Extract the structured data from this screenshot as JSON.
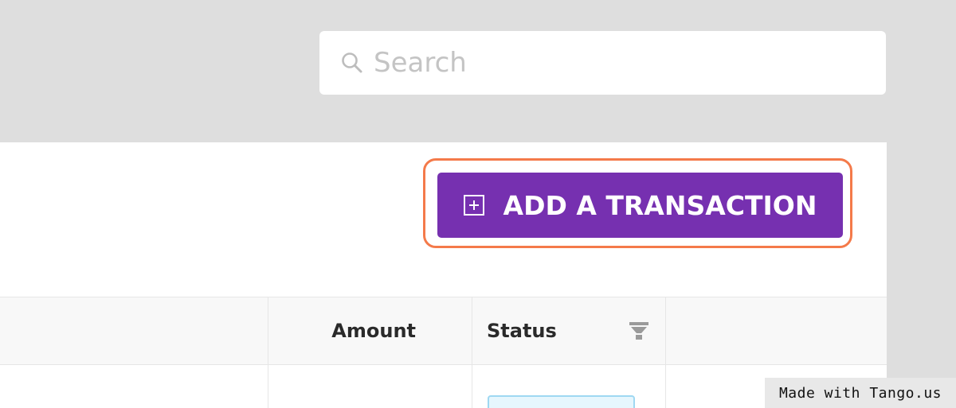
{
  "search": {
    "placeholder": "Search",
    "icon": "search-icon"
  },
  "toolbar": {
    "add_transaction_label": "ADD A TRANSACTION",
    "add_icon": "plus-square-icon",
    "button_color": "#7630b0",
    "highlight_color": "#f47a4a"
  },
  "table": {
    "columns": [
      "",
      "Amount",
      "Status",
      ""
    ],
    "status_filter_icon": "filter-icon"
  },
  "watermark": {
    "text": "Made with Tango.us"
  }
}
